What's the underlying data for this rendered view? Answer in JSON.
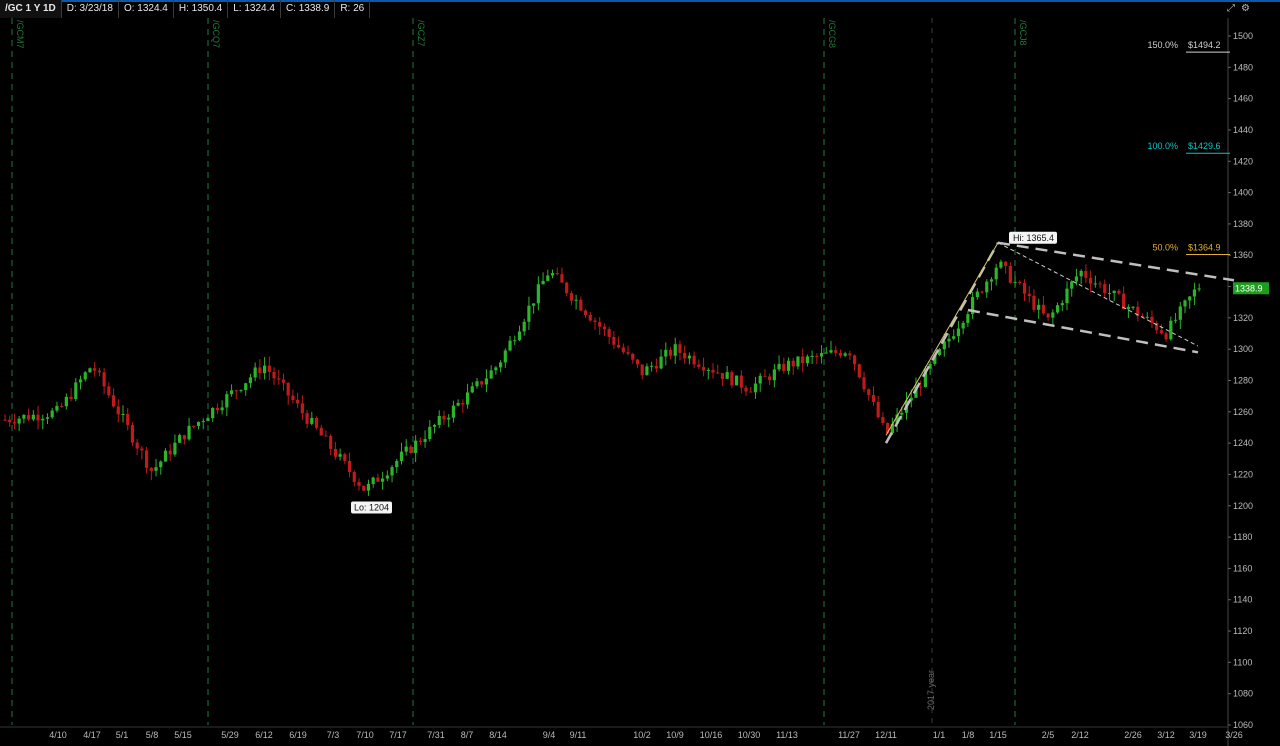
{
  "header": {
    "symbol": "/GC 1 Y 1D",
    "date": "D: 3/23/18",
    "open": "O: 1324.4",
    "high": "H: 1350.4",
    "low": "L: 1324.4",
    "close": "C: 1338.9",
    "range": "R: 26"
  },
  "colors": {
    "up": "#2bb52b",
    "down": "#c01a1a",
    "grid": "#1e7a3a",
    "accent": "#00c8c8",
    "fib50": "#e0b030",
    "last": "#1e9e1e"
  },
  "chart_data": {
    "type": "candlestick",
    "title": "",
    "xlabel": "",
    "ylabel": "",
    "ylim": [
      1060,
      1510
    ],
    "y_ticks": [
      1060,
      1080,
      1100,
      1120,
      1140,
      1160,
      1180,
      1200,
      1220,
      1240,
      1260,
      1280,
      1300,
      1320,
      1340,
      1360,
      1380,
      1400,
      1420,
      1440,
      1460,
      1480,
      1500
    ],
    "x_ticks": [
      "4/10",
      "4/17",
      "5/1",
      "5/8",
      "5/15",
      "5/29",
      "6/12",
      "6/19",
      "7/3",
      "7/10",
      "7/17",
      "7/31",
      "8/7",
      "8/14",
      "9/4",
      "9/11",
      "10/2",
      "10/9",
      "10/16",
      "10/30",
      "11/13",
      "11/27",
      "12/11",
      "1/1",
      "1/8",
      "1/15",
      "2/5",
      "2/12",
      "2/26",
      "3/12",
      "3/19",
      "3/26"
    ],
    "contract_markers": [
      "/GCM7",
      "/GCQ7",
      "/GCZ7",
      "/GCG8",
      "/GCJ8"
    ],
    "year_marker": "2017 year",
    "path_x": [
      "start",
      "4/10",
      "4/17",
      "5/8",
      "5/15",
      "6/12",
      "7/10",
      "8/7",
      "8/14",
      "9/4",
      "9/11",
      "10/2",
      "10/9",
      "10/30",
      "11/13",
      "11/27",
      "12/11",
      "1/15",
      "2/5",
      "2/12",
      "2/26",
      "3/12",
      "3/19"
    ],
    "path_y": [
      1255,
      1260,
      1290,
      1222,
      1245,
      1290,
      1210,
      1270,
      1290,
      1350,
      1330,
      1285,
      1300,
      1275,
      1290,
      1300,
      1245,
      1355,
      1318,
      1350,
      1325,
      1310,
      1340
    ],
    "annotations": {
      "hi": "Hi: 1365.4",
      "lo": "Lo: 1204"
    },
    "fib_levels": [
      {
        "pct": "150.0%",
        "price": "$1494.2",
        "value": 1494.2
      },
      {
        "pct": "100.0%",
        "price": "$1429.6",
        "value": 1429.6
      },
      {
        "pct": "50.0%",
        "price": "$1364.9",
        "value": 1364.9
      }
    ],
    "last_price": "1338.9",
    "last_value": 1338.9,
    "trendlines": [
      {
        "style": "dashed",
        "from": [
          "12/11",
          1240
        ],
        "to": [
          "1/15",
          1368
        ]
      },
      {
        "style": "solid",
        "from": [
          "12/11",
          1245
        ],
        "to": [
          "1/15",
          1368
        ]
      },
      {
        "style": "dashed",
        "from": [
          "1/15",
          1368
        ],
        "to": [
          "3/26",
          1344
        ]
      },
      {
        "style": "dashed",
        "from": [
          "1/8",
          1325
        ],
        "to": [
          "3/19",
          1298
        ]
      },
      {
        "style": "thin",
        "from": [
          "1/15",
          1368
        ],
        "to": [
          "3/19",
          1302
        ]
      }
    ],
    "grid": false,
    "legend": "none"
  }
}
